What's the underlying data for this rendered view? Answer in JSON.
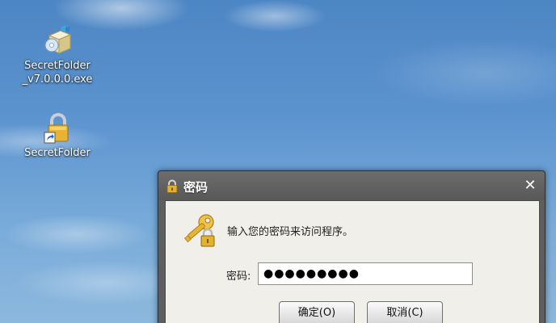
{
  "desktop": {
    "icons": [
      {
        "label": "SecretFolder\n_v7.0.0.0.exe",
        "icon": "installer-box-icon"
      },
      {
        "label": "SecretFolder",
        "icon": "shortcut-lock-icon"
      }
    ]
  },
  "dialog": {
    "title": "密码",
    "close_glyph": "✕",
    "prompt": "输入您的密码来访问程序。",
    "password_label": "密码:",
    "password_value": "●●●●●●●●●",
    "ok_label": "确定(O)",
    "cancel_label": "取消(C)"
  },
  "colors": {
    "titlebar": "#5e5e5e",
    "client": "#f1efe9",
    "lock_gold": "#e0b234",
    "key_gold": "#e8b83a"
  }
}
